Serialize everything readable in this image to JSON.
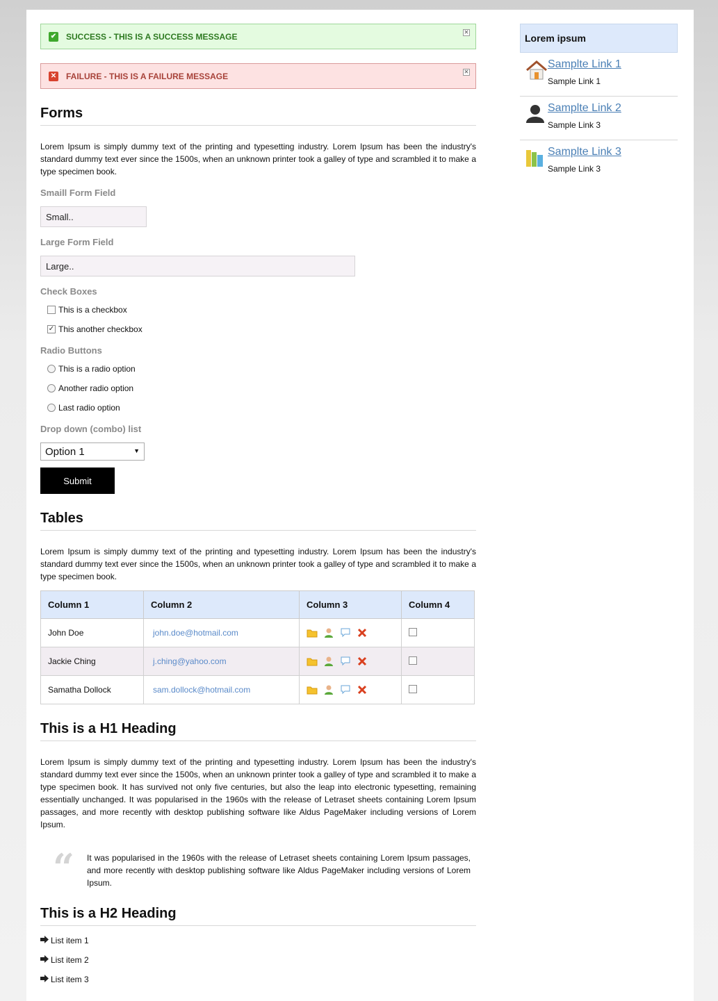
{
  "messages": {
    "success": "SUCCESS - THIS IS A SUCCESS MESSAGE",
    "failure": "FAILURE - THIS IS A FAILURE MESSAGE"
  },
  "forms": {
    "heading": "Forms",
    "intro": "Lorem Ipsum is simply dummy text of the printing and typesetting industry. Lorem Ipsum has been the industry's standard dummy text ever since the 1500s, when an unknown printer took a galley of type and scrambled it to make a type specimen book.",
    "small_label": "Smaill Form Field",
    "small_value": "Small..",
    "large_label": "Large Form Field",
    "large_value": "Large..",
    "checkbox_label": "Check Boxes",
    "checkboxes": [
      {
        "label": "This is a checkbox",
        "checked": false
      },
      {
        "label": "This another checkbox",
        "checked": true
      }
    ],
    "radio_label": "Radio Buttons",
    "radios": [
      "This is a radio option",
      "Another radio option",
      "Last radio option"
    ],
    "dropdown_label": "Drop down (combo) list",
    "dropdown_value": "Option 1",
    "submit": "Submit"
  },
  "tables": {
    "heading": "Tables",
    "intro": "Lorem Ipsum is simply dummy text of the printing and typesetting industry. Lorem Ipsum has been the industry's standard dummy text ever since the 1500s, when an unknown printer took a galley of type and scrambled it to make a type specimen book.",
    "columns": [
      "Column 1",
      "Column 2",
      "Column 3",
      "Column 4"
    ],
    "rows": [
      {
        "name": "John Doe",
        "email": "john.doe@hotmail.com"
      },
      {
        "name": "Jackie Ching",
        "email": "j.ching@yahoo.com"
      },
      {
        "name": "Samatha Dollock",
        "email": "sam.dollock@hotmail.com"
      }
    ],
    "row_icons": [
      "folder-icon",
      "user-icon",
      "comment-icon",
      "delete-icon"
    ]
  },
  "h1": {
    "heading": "This is a H1 Heading",
    "text": "Lorem Ipsum is simply dummy text of the printing and typesetting industry. Lorem Ipsum has been the industry's standard dummy text ever since the 1500s, when an unknown printer took a galley of type and scrambled it to make a type specimen book. It has survived not only five centuries, but also the leap into electronic typesetting, remaining essentially unchanged. It was popularised in the 1960s with the release of Letraset sheets containing Lorem Ipsum passages, and more recently with desktop publishing software like Aldus PageMaker including versions of Lorem Ipsum.",
    "quote": "It was popularised in the 1960s with the release of Letraset sheets containing Lorem Ipsum passages, and more recently with desktop publishing software like Aldus PageMaker including versions of Lorem Ipsum."
  },
  "h2": {
    "heading": "This is a H2 Heading",
    "items": [
      "List item 1",
      "List item 2",
      "List item 3"
    ]
  },
  "sidebar": {
    "title": "Lorem ipsum",
    "items": [
      {
        "link": "Samplte Link 1",
        "sub": "Sample Link 1",
        "icon": "home-icon"
      },
      {
        "link": "Samplte Link 2",
        "sub": "Sample Link 3",
        "icon": "user-silhouette-icon"
      },
      {
        "link": "Samplte Link 3",
        "sub": "Sample Link 3",
        "icon": "books-icon"
      }
    ]
  },
  "colors": {
    "accent_blue": "#dde9fb",
    "success_bg": "#e4fbe0",
    "failure_bg": "#fde2e2",
    "link": "#4a7fb5"
  }
}
